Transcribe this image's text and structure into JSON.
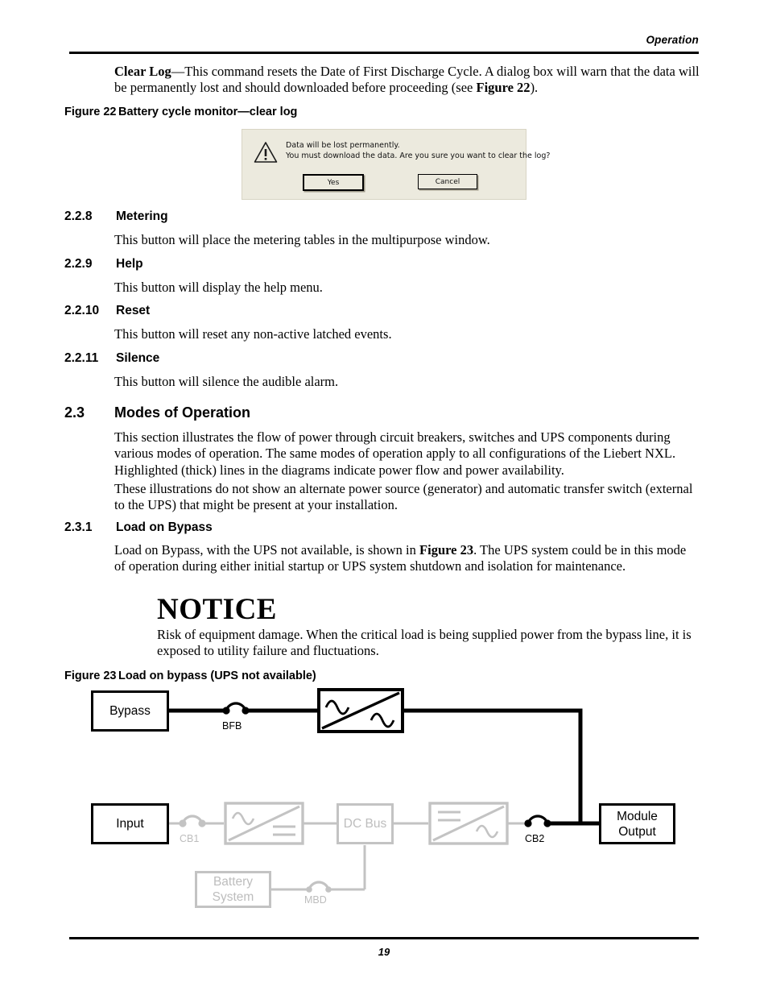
{
  "header": {
    "title": "Operation"
  },
  "footer": {
    "page_number": "19"
  },
  "intro": {
    "html": "<b>Clear Log</b>&mdash;This command resets the Date of First Discharge Cycle. A dialog box will warn that the data will be permanently lost and should downloaded before proceeding (see <b>Figure 22</b>)."
  },
  "figure22": {
    "caption_number": "Figure 22",
    "caption_title": "Battery cycle monitor—clear log",
    "dialog": {
      "icon": "warning-triangle-icon",
      "line1": "Data will be lost permanently.",
      "line2": "You must download the data. Are you sure you want to clear the log?",
      "yes_label": "Yes",
      "cancel_label": "Cancel"
    }
  },
  "sections": [
    {
      "number": "2.2.8",
      "title": "Metering",
      "body": "This button will place the metering tables in the multipurpose window."
    },
    {
      "number": "2.2.9",
      "title": "Help",
      "body": "This button will display the help menu."
    },
    {
      "number": "2.2.10",
      "title": "Reset",
      "body": "This button will reset any non-active latched events."
    },
    {
      "number": "2.2.11",
      "title": "Silence",
      "body": "This button will silence the audible alarm."
    }
  ],
  "modes": {
    "number": "2.3",
    "title": "Modes of Operation",
    "paragraph1": "This section illustrates the flow of power through circuit breakers, switches and UPS components during various modes of operation. The same modes of operation apply to all configurations of the Liebert NXL. Highlighted (thick) lines in the diagrams indicate power flow and power availability.",
    "paragraph2": "These illustrations do not show an alternate power source (generator) and automatic transfer switch (external to the UPS) that might be present at your installation."
  },
  "load_on_bypass": {
    "number": "2.3.1",
    "title": "Load on Bypass",
    "paragraph_html": "Load on Bypass, with the UPS not available, is shown in <b>Figure 23</b>. The UPS system could be in this mode of operation during either initial startup or UPS system shutdown and isolation for maintenance.",
    "notice_title": "NOTICE",
    "notice_body": "Risk of equipment damage. When the critical load is being supplied power from the bypass line, it is exposed to utility failure and fluctuations."
  },
  "figure23": {
    "caption_number": "Figure 23",
    "caption_title": "Load on bypass (UPS not available)",
    "blocks": [
      {
        "id": "bypass",
        "label": "Bypass",
        "state": "active"
      },
      {
        "id": "static-switch",
        "label": "",
        "state": "active",
        "symbol": "ac-ac-converter-icon"
      },
      {
        "id": "input",
        "label": "Input",
        "state": "active"
      },
      {
        "id": "rectifier",
        "label": "",
        "state": "inactive",
        "symbol": "ac-dc-rectifier-icon"
      },
      {
        "id": "dc-bus",
        "label": "DC Bus",
        "state": "inactive"
      },
      {
        "id": "inverter",
        "label": "",
        "state": "inactive",
        "symbol": "dc-ac-inverter-icon"
      },
      {
        "id": "module-output",
        "label": "Module\nOutput",
        "state": "active"
      },
      {
        "id": "battery",
        "label": "Battery\nSystem",
        "state": "inactive"
      }
    ],
    "breakers": [
      {
        "id": "bfb",
        "label": "BFB",
        "state": "active"
      },
      {
        "id": "cb1",
        "label": "CB1",
        "state": "inactive"
      },
      {
        "id": "cb2",
        "label": "CB2",
        "state": "active"
      },
      {
        "id": "mbd",
        "label": "MBD",
        "state": "inactive"
      }
    ],
    "colors": {
      "active": "#000000",
      "inactive": "#c3c3c3",
      "inactive_text": "#bdbdbd"
    }
  }
}
